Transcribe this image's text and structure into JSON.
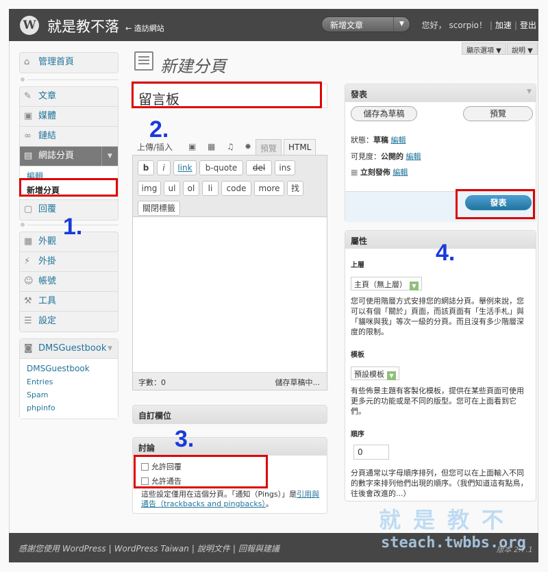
{
  "header": {
    "site_title": "就是教不落",
    "visit_site": "← 造訪網站",
    "favorite_action": "新增文章",
    "greeting": "您好， scorpio！",
    "add_link": "加速",
    "logout_link": "登出",
    "logo_letter": "W"
  },
  "screen_options": {
    "options_label": "顯示選項 ▼",
    "help_label": "說明 ▼"
  },
  "sidebar": {
    "dashboard": "管理首頁",
    "posts": "文章",
    "media": "媒體",
    "links": "鏈結",
    "pages": "網誌分頁",
    "pages_sub_edit": "編輯",
    "pages_sub_new": "新增分頁",
    "comments": "回覆",
    "appearance": "外觀",
    "plugins": "外掛",
    "users": "帳號",
    "tools": "工具",
    "settings": "設定",
    "plugin_menu_title": "DMSGuestbook",
    "plugin_items": [
      "DMSGuestbook",
      "Entries",
      "Spam",
      "phpinfo"
    ]
  },
  "page": {
    "heading": "新建分頁",
    "title_value": "留言板"
  },
  "editor": {
    "upload_label": "上傳/插入",
    "tab_visual": "預覽",
    "tab_html": "HTML",
    "buttons_row1": [
      "b",
      "i",
      "link",
      "b-quote",
      "del",
      "ins"
    ],
    "buttons_row2": [
      "img",
      "ul",
      "ol",
      "li",
      "code",
      "more",
      "找"
    ],
    "buttons_row3": [
      "關閉標籤"
    ],
    "word_count": "字數：0",
    "draft_status": "儲存草稿中..."
  },
  "custom_fields": {
    "title": "自訂欄位"
  },
  "discussion": {
    "title": "討論",
    "allow_comments": "允許回覆",
    "allow_pings": "允許通告",
    "note_prefix": "這些設定僅用在這個分頁。「通知（Pings）」是",
    "note_link": "引用與通告（trackbacks and pingbacks）",
    "note_suffix": "。"
  },
  "publish": {
    "title": "發表",
    "save_draft": "儲存為草稿",
    "preview": "預覽",
    "status_label": "狀態：",
    "status_value": "草稿",
    "visibility_label": "可見度：",
    "visibility_value": "公開的",
    "edit": "編輯",
    "schedule": "立刻發佈",
    "publish_button": "發表"
  },
  "attributes": {
    "title": "屬性",
    "parent_label": "上層",
    "parent_value": "主頁（無上層）",
    "parent_desc": "您可使用階層方式安排您的網誌分頁。舉例來說，您可以有個「關於」頁面，而該頁面有「生活手札」與「貓咪與我」等次一級的分頁。而且沒有多少階層深度的限制。",
    "template_label": "模板",
    "template_value": "預設模板",
    "template_desc": "有些佈景主題有客製化模板，提供在某些頁面可使用更多元的功能或是不同的版型。您可在上面看到它們。",
    "order_label": "順序",
    "order_value": "0",
    "order_desc": "分頁通常以字母順序排列，但您可以在上面輸入不同的數字來排列他們出現的順序。（我們知道這有點鳥，往後會改進的...）"
  },
  "annotations": {
    "n1": "1.",
    "n2": "2.",
    "n3": "3.",
    "n4": "4."
  },
  "footer": {
    "thanks": "感謝您使用 WordPress",
    "wp_tw": "WordPress Taiwan",
    "docs": "說明文件",
    "feedback": "回報與建議",
    "version": "版本 2.7.1"
  },
  "watermark": {
    "line1": "就是教不落",
    "line2": "steach.twbbs.org"
  },
  "colors": {
    "accent": "#21759b",
    "header_bg": "#464646",
    "highlight": "#dd0000",
    "annotation": "#1a3adb"
  }
}
